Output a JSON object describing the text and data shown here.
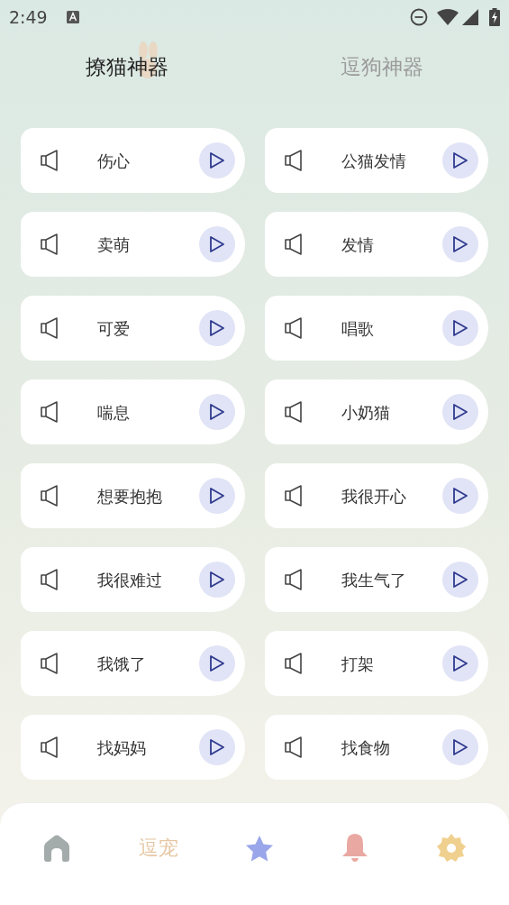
{
  "status_bar": {
    "time": "2:49"
  },
  "tabs": [
    {
      "label": "撩猫神器",
      "selected": true
    },
    {
      "label": "逗狗神器",
      "selected": false
    }
  ],
  "sounds": [
    {
      "label": "伤心"
    },
    {
      "label": "公猫发情"
    },
    {
      "label": "卖萌"
    },
    {
      "label": "发情"
    },
    {
      "label": "可爱"
    },
    {
      "label": "唱歌"
    },
    {
      "label": "喘息"
    },
    {
      "label": "小奶猫"
    },
    {
      "label": "想要抱抱"
    },
    {
      "label": "我很开心"
    },
    {
      "label": "我很难过"
    },
    {
      "label": "我生气了"
    },
    {
      "label": "我饿了"
    },
    {
      "label": "打架"
    },
    {
      "label": "找妈妈"
    },
    {
      "label": "找食物"
    }
  ],
  "bottom_nav": {
    "label": "逗宠"
  }
}
